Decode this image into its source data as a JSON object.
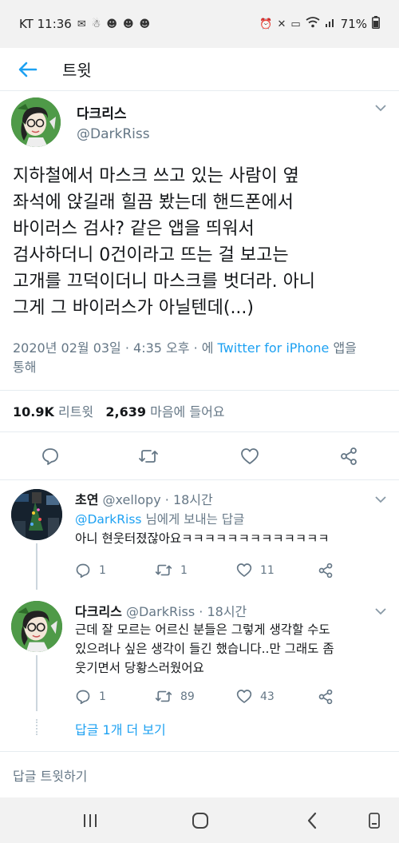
{
  "status_bar": {
    "carrier_time": "KT 11:36",
    "battery": "71%"
  },
  "app_bar": {
    "title": "트윗"
  },
  "tweet": {
    "author_name": "다크리스",
    "author_handle": "@DarkRiss",
    "text_lines": [
      "지하철에서 마스크 쓰고 있는 사람이 옆",
      "좌석에 앉길래 힐끔 봤는데 핸드폰에서",
      "바이러스 검사? 같은 앱을 띄워서",
      "검사하더니 0건이라고 뜨는 걸 보고는",
      "고개를 끄덕이더니 마스크를 벗더라. 아니",
      "그게 그 바이러스가 아닐텐데(...)"
    ],
    "meta_prefix": "2020년 02월 03일 · 4:35 오후 · 에 ",
    "meta_source": "Twitter for iPhone",
    "meta_suffix": " 앱을",
    "meta_line2": "통해",
    "retweets_count": "10.9K",
    "retweets_label": "리트윗",
    "likes_count": "2,639",
    "likes_label": "마음에 들어요"
  },
  "replies": [
    {
      "name": "초연",
      "handle": "@xellopy",
      "time": "· 18시간",
      "reply_to_mention": "@DarkRiss",
      "reply_to_suffix": " 님에게 보내는 답글",
      "text_lines": [
        "아니 현웃터졌잖아요ㅋㅋㅋㅋㅋㅋㅋㅋㅋㅋㅋㅋㅋ"
      ],
      "reply_count": "1",
      "retweet_count": "1",
      "like_count": "11"
    },
    {
      "name": "다크리스",
      "handle": "@DarkRiss",
      "time": "· 18시간",
      "text_lines": [
        "근데 잘 모르는 어르신 분들은 그렇게 생각할 수도",
        "있으려나 싶은 생각이 들긴 했습니다..만 그래도 좀",
        "웃기면서 당황스러웠어요"
      ],
      "reply_count": "1",
      "retweet_count": "89",
      "like_count": "43"
    }
  ],
  "more_replies_label": "답글 1개 더 보기",
  "compose_placeholder": "답글 트윗하기",
  "colors": {
    "accent": "#1da1f2",
    "muted": "#657786",
    "text": "#14171a"
  },
  "icons": [
    "mail-icon",
    "wifi-icon",
    "signal-icon",
    "battery-icon",
    "back-arrow-icon",
    "reply-icon",
    "retweet-icon",
    "like-icon",
    "share-icon",
    "chevron-down-icon",
    "recents-icon",
    "home-icon",
    "nav-back-icon",
    "rotate-icon"
  ]
}
